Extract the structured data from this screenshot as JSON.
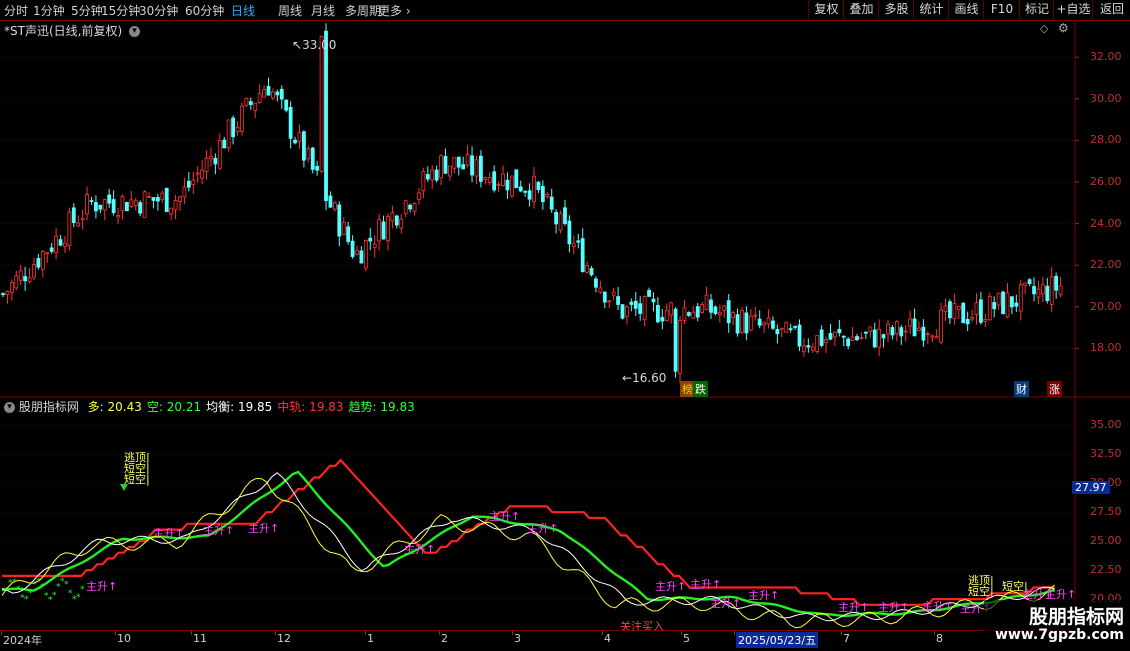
{
  "toolbar": {
    "periods": [
      "分时",
      "1分钟",
      "5分钟",
      "15分钟",
      "30分钟",
      "60分钟",
      "日线",
      "周线",
      "月线",
      "多周期",
      "更多"
    ],
    "active_period": "日线",
    "buttons": [
      "复权",
      "叠加",
      "多股",
      "统计",
      "画线",
      "F10",
      "标记",
      "+自选",
      "返回"
    ]
  },
  "chart_header": {
    "title": "*ST声迅(日线,前复权)"
  },
  "price_axis": {
    "ticks": [
      "32.00",
      "30.00",
      "28.00",
      "26.00",
      "24.00",
      "22.00",
      "20.00",
      "18.00"
    ]
  },
  "annotations": {
    "high": "33.00",
    "low": "16.60",
    "tag_rank": "榜",
    "tag_fall": "跌",
    "tag_finance": "财",
    "tag_rise": "涨"
  },
  "indicator": {
    "name": "股朋指标网",
    "items": [
      {
        "label": "多:",
        "value": "20.43",
        "color": "#ffff44"
      },
      {
        "label": "空:",
        "value": "20.21",
        "color": "#33ff33"
      },
      {
        "label": "均衡:",
        "value": "19.85",
        "color": "#ffffff"
      },
      {
        "label": "中轨:",
        "value": "19.83",
        "color": "#ff3333"
      },
      {
        "label": "趋势:",
        "value": "19.83",
        "color": "#33ff33"
      }
    ],
    "axis_ticks": [
      "35.00",
      "32.50",
      "30.00",
      "27.50",
      "25.00",
      "22.50",
      "20.00"
    ],
    "current_value": "27.97",
    "signals": {
      "escape_top": "逃顶",
      "short_empty": "短空",
      "main_rise": "主升",
      "watch_buy": "关注买入"
    }
  },
  "date_axis": {
    "labels": [
      "2024年",
      "10",
      "11",
      "12",
      "1",
      "2",
      "3",
      "4",
      "5",
      "2025/05/23/五",
      "7",
      "8"
    ]
  },
  "watermark": {
    "name": "股朋指标网",
    "url": "www.7gpzb.com"
  },
  "chart_data": {
    "type": "candlestick",
    "title": "*ST声迅(日线,前复权)",
    "price_range": [
      16.0,
      33.5
    ],
    "high": 33.0,
    "low": 16.6,
    "approx_close_path": [
      {
        "x": "2024-09",
        "y": 20.6
      },
      {
        "x": "2024-10",
        "y": 25.0
      },
      {
        "x": "2024-11",
        "y": 25.2
      },
      {
        "x": "2024-12",
        "y": 30.8
      },
      {
        "x": "2025-01",
        "y": 22.5
      },
      {
        "x": "2025-02",
        "y": 27.0
      },
      {
        "x": "2025-03",
        "y": 25.8
      },
      {
        "x": "2025-04",
        "y": 19.8
      },
      {
        "x": "2025-05",
        "y": 19.9
      },
      {
        "x": "2025-06",
        "y": 18.4
      },
      {
        "x": "2025-07",
        "y": 18.6
      },
      {
        "x": "2025-08",
        "y": 19.7
      },
      {
        "x": "2025-09",
        "y": 21.0
      }
    ],
    "indicator_range": [
      17.5,
      36.5
    ],
    "indicator_series": [
      {
        "name": "多",
        "last": 20.43
      },
      {
        "name": "空",
        "last": 20.21
      },
      {
        "name": "均衡",
        "last": 19.85
      },
      {
        "name": "中轨",
        "last": 19.83
      },
      {
        "name": "趋势",
        "last": 19.83
      }
    ]
  }
}
